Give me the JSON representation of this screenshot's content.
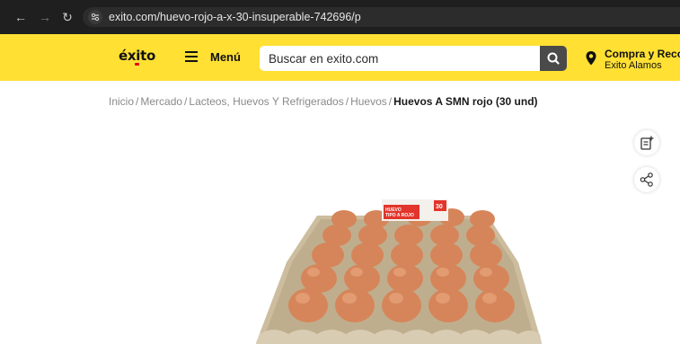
{
  "browser": {
    "url": "exito.com/huevo-rojo-a-x-30-insuperable-742696/p"
  },
  "header": {
    "logo": "éxito",
    "menu_label": "Menú",
    "search_placeholder": "Buscar en exito.com",
    "location_line1": "Compra y Recog",
    "location_line2": "Exito Alamos"
  },
  "breadcrumb": {
    "items": [
      "Inicio",
      "Mercado",
      "Lacteos, Huevos Y Refrigerados",
      "Huevos"
    ],
    "current": "Huevos A SMN rojo (30 und)"
  },
  "product": {
    "label_text_1": "HUEVO",
    "label_text_2": "TIPO A ROJO",
    "label_badge": "30"
  },
  "colors": {
    "header_bg": "#ffe033",
    "chrome_bg": "#1f1f1f",
    "search_button": "#4a4a4a",
    "egg": "#d9875a",
    "tray": "#c9b99a"
  }
}
